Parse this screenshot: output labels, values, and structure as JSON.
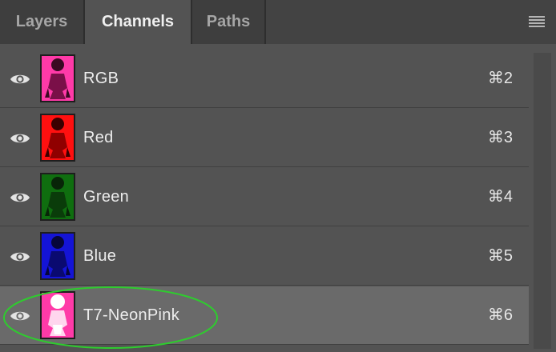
{
  "tabs": [
    {
      "label": "Layers",
      "active": false
    },
    {
      "label": "Channels",
      "active": true
    },
    {
      "label": "Paths",
      "active": false
    }
  ],
  "menu_icon": "panel-menu-icon",
  "channels": [
    {
      "label": "RGB",
      "shortcut": "⌘2",
      "thumb_color": "#ff3aa8",
      "selected": false
    },
    {
      "label": "Red",
      "shortcut": "⌘3",
      "thumb_color": "#ff1010",
      "selected": false
    },
    {
      "label": "Green",
      "shortcut": "⌘4",
      "thumb_color": "#0f6e0f",
      "selected": false
    },
    {
      "label": "Blue",
      "shortcut": "⌘5",
      "thumb_color": "#1414d6",
      "selected": false
    },
    {
      "label": "T7-NeonPink",
      "shortcut": "⌘6",
      "thumb_color": "#ff3aa8",
      "selected": true
    }
  ],
  "annotation": {
    "color": "#2ecc2e",
    "shape": "ellipse"
  }
}
